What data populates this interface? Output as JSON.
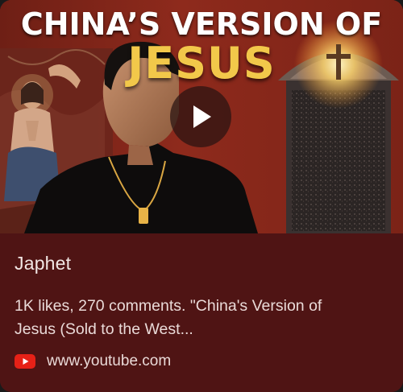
{
  "thumbnail": {
    "title_line_1": "CHINA’S VERSION OF",
    "title_line_2": "JESUS",
    "play_icon": "play-icon"
  },
  "result": {
    "channel": "Japhet",
    "description_line_1": "1K likes, 270 comments. \"China's Version of",
    "description_line_2": "Jesus (Sold to the West...",
    "source_icon": "youtube-icon",
    "source_url": "www.youtube.com"
  },
  "colors": {
    "card_background": "#4f1414",
    "title_gold": "#f2c84a",
    "youtube_red": "#e62117"
  }
}
